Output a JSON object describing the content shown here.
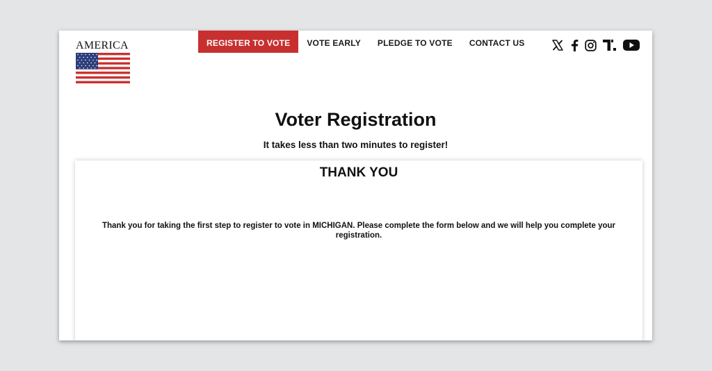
{
  "logo": {
    "text": "AMERICA"
  },
  "nav": {
    "items": [
      {
        "label": "REGISTER TO VOTE"
      },
      {
        "label": "VOTE EARLY"
      },
      {
        "label": "PLEDGE TO VOTE"
      },
      {
        "label": "CONTACT US"
      }
    ]
  },
  "social": {
    "icons": [
      "x-icon",
      "facebook-icon",
      "instagram-icon",
      "truth-social-icon",
      "youtube-icon"
    ]
  },
  "main": {
    "heading": "Voter Registration",
    "subheading": "It takes less than two minutes to register!"
  },
  "card": {
    "title": "THANK YOU",
    "message": "Thank you for taking the first step to register to vote in MICHIGAN. Please complete the form below and we will help you complete your registration."
  },
  "colors": {
    "accent": "#c8302f",
    "flag_blue": "#2c3e7a",
    "background": "#e4e5e7"
  }
}
